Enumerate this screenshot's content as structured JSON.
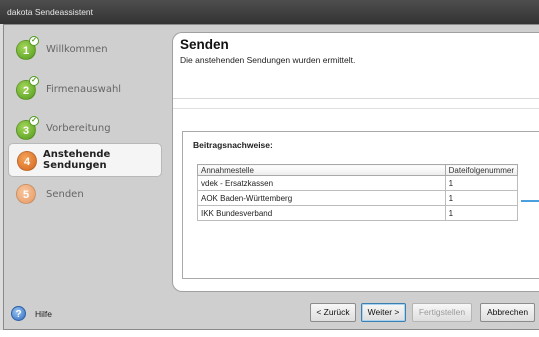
{
  "window": {
    "title": "dakota Sendeassistent"
  },
  "steps": [
    {
      "number": "1",
      "label": "Willkommen",
      "state": "done",
      "color": "#5fae26"
    },
    {
      "number": "2",
      "label": "Firmenauswahl",
      "state": "done",
      "color": "#5fae26"
    },
    {
      "number": "3",
      "label": "Vorbereitung",
      "state": "done",
      "color": "#5fae26"
    },
    {
      "number": "4",
      "label_line1": "Anstehende",
      "label_line2": "Sendungen",
      "state": "active",
      "color": "#e0742b"
    },
    {
      "number": "5",
      "label": "Senden",
      "state": "pending",
      "color": "#eba678"
    }
  ],
  "main": {
    "title": "Senden",
    "subtitle": "Die anstehenden Sendungen wurden ermittelt.",
    "section_title": "Beitragsnachweise:",
    "table": {
      "headers": [
        "Annahmestelle",
        "Dateifolgenummer"
      ],
      "rows": [
        [
          "vdek - Ersatzkassen",
          "1"
        ],
        [
          "AOK Baden-Württemberg",
          "1"
        ],
        [
          "IKK Bundesverband",
          "1"
        ]
      ]
    }
  },
  "footer": {
    "help_label": "Hilfe",
    "back_label": "< Zurück",
    "next_label": "Weiter >",
    "finish_label": "Fertigstellen",
    "cancel_label": "Abbrechen"
  },
  "colors": {
    "accent": "#4aa0dc",
    "step_done": "#5fae26",
    "step_active": "#e0742b"
  }
}
